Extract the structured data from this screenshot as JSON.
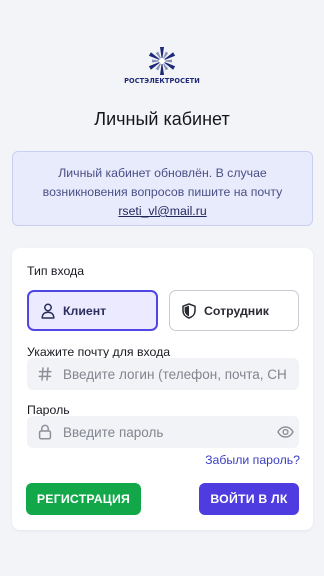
{
  "logo": {
    "text": "РОСТЭЛЕКТРОСЕТИ"
  },
  "page": {
    "title": "Личный кабинет"
  },
  "notice": {
    "line1": "Личный кабинет обновлён. В случае",
    "line2": "возникновения вопросов пишите на почту",
    "email": "rseti_vl@mail.ru"
  },
  "form": {
    "login_type_label": "Тип входа",
    "roles": [
      {
        "label": "Клиент",
        "icon": "user-icon",
        "selected": true
      },
      {
        "label": "Сотрудник",
        "icon": "shield-icon",
        "selected": false
      }
    ],
    "email_label": "Укажите почту для входа",
    "email_placeholder": "Введите логин (телефон, почта, СН",
    "email_value": "",
    "password_label": "Пароль",
    "password_placeholder": "Введите пароль",
    "password_value": "",
    "forgot_label": "Забыли пароль?",
    "register_label": "РЕГИСТРАЦИЯ",
    "login_label": "ВОЙТИ В ЛК"
  },
  "colors": {
    "accent": "#4f46e5",
    "primary_button": "#4f3ce0",
    "register_button": "#12a84a",
    "notice_bg": "#e8ebfc",
    "page_bg": "#f3f4f8"
  }
}
